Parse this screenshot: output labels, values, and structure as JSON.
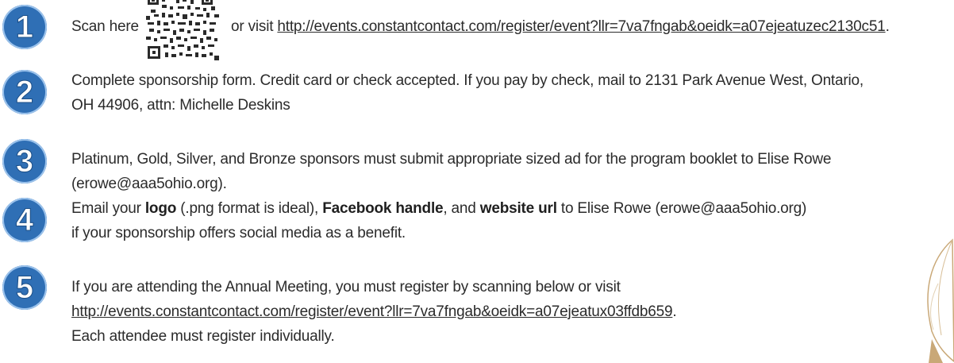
{
  "steps": [
    {
      "number": "1",
      "before": "Scan here",
      "middle": "or visit",
      "link": "http://events.constantcontact.com/register/event?llr=7va7fngab&oeidk=a07ejeatuzec2130c51",
      "after": "."
    },
    {
      "number": "2",
      "line1": "Complete sponsorship form. Credit card or check accepted. If you pay by check, mail to 2131 Park Avenue West, Ontario,",
      "line2": "OH 44906, attn: Michelle Deskins"
    },
    {
      "number": "3",
      "line1": "Platinum, Gold, Silver, and Bronze sponsors must submit appropriate sized ad for the program booklet to Elise Rowe",
      "line2": "(erowe@aaa5ohio.org)."
    },
    {
      "number": "4",
      "prefix": "Email your",
      "bold1": "logo",
      "mid1": "(.png format is ideal),",
      "bold2": "Facebook handle",
      "mid2": ", and",
      "bold3": "website url",
      "suffix": "to Elise Rowe (erowe@aaa5ohio.org)",
      "line2": "if your sponsorship offers social media as a benefit."
    },
    {
      "number": "5",
      "line1": "If you are attending the Annual Meeting, you must register by scanning below or visit",
      "link": "http://events.constantcontact.com/register/event?llr=7va7fngab&oeidk=a07ejeatux03ffdb659",
      "after": ".",
      "line3": "Each attendee must register individually."
    }
  ],
  "colors": {
    "badge": "#2f6fb5",
    "text": "#2b2b2b",
    "leaf": "#c9a877"
  }
}
